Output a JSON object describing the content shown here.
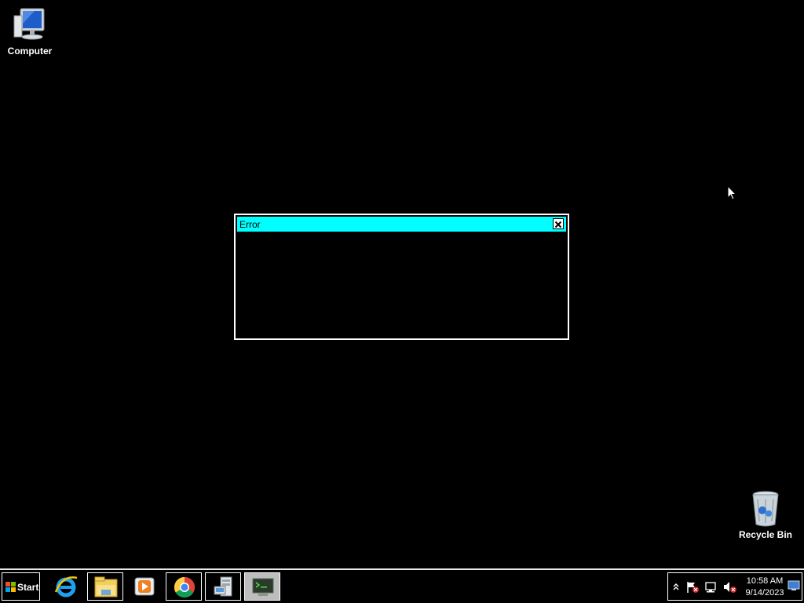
{
  "desktop": {
    "background": "#000000",
    "icons": [
      {
        "label": "Computer",
        "icon": "computer-icon"
      },
      {
        "label": "Recycle Bin",
        "icon": "recycle-bin-icon"
      }
    ]
  },
  "dialog": {
    "title": "Error",
    "titlebar_color": "#00ffff",
    "close_icon": "close-icon"
  },
  "taskbar": {
    "start_label": "Start",
    "pinned": [
      {
        "app": "Internet Explorer",
        "icon": "internet-explorer-icon"
      },
      {
        "app": "File Explorer",
        "icon": "file-explorer-icon"
      },
      {
        "app": "Media Player",
        "icon": "media-player-icon"
      },
      {
        "app": "Chrome",
        "icon": "chrome-icon"
      },
      {
        "app": "Server Manager",
        "icon": "server-manager-icon"
      },
      {
        "app": "Terminal",
        "icon": "terminal-icon"
      }
    ],
    "tray": {
      "icons": [
        "show-hidden-icons-icon",
        "action-center-icon",
        "network-icon",
        "volume-muted-icon"
      ],
      "time": "10:58 AM",
      "date": "9/14/2023"
    }
  }
}
